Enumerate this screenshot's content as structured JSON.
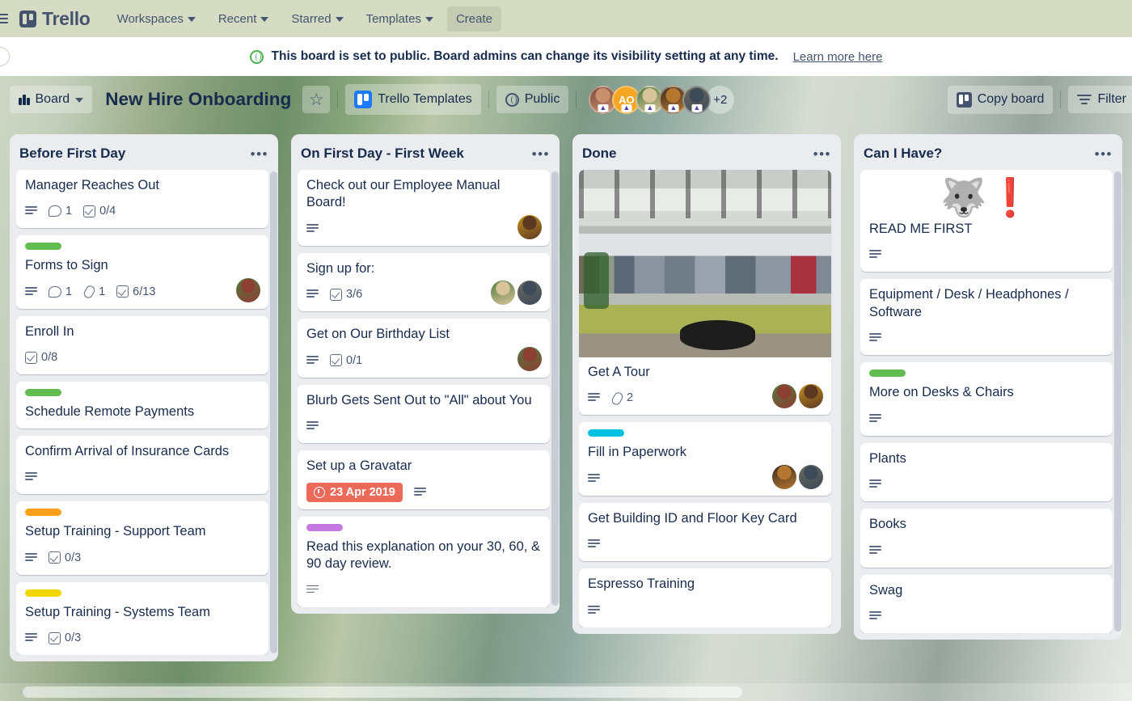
{
  "topnav": {
    "menu_icon": "hamburger-icon",
    "brand": "Trello",
    "items": [
      {
        "label": "Workspaces",
        "has_caret": true,
        "active": false
      },
      {
        "label": "Recent",
        "has_caret": true,
        "active": false
      },
      {
        "label": "Starred",
        "has_caret": true,
        "active": false
      },
      {
        "label": "Templates",
        "has_caret": true,
        "active": false
      },
      {
        "label": "Create",
        "has_caret": false,
        "active": true
      }
    ]
  },
  "banner": {
    "icon": "globe-icon",
    "text": "This board is set to public. Board admins can change its visibility setting at any time.",
    "link": "Learn more here"
  },
  "boardbar": {
    "view_label": "Board",
    "view_icon": "board-view-icon",
    "title": "New Hire Onboarding",
    "star_icon": "star-icon",
    "workspace_label": "Trello Templates",
    "workspace_icon": "trello-logo-icon",
    "visibility_label": "Public",
    "visibility_icon": "globe-icon",
    "members": [
      {
        "type": "photo",
        "name": "member-1",
        "color1": "#7b4a3a",
        "color2": "#c98f6e"
      },
      {
        "type": "initials",
        "name": "member-ao",
        "initials": "AO",
        "color": "#f5a623"
      },
      {
        "type": "photo",
        "name": "member-3",
        "color1": "#4f7a3c",
        "color2": "#d8c49a"
      },
      {
        "type": "photo",
        "name": "member-4",
        "color1": "#3a2a20",
        "color2": "#b5762f"
      },
      {
        "type": "photo",
        "name": "member-5",
        "color1": "#6e6a5a",
        "color2": "#3c4a5a"
      }
    ],
    "members_overflow": "+2",
    "copy_board_label": "Copy board",
    "copy_board_icon": "copy-board-icon",
    "filter_label": "Filter",
    "filter_icon": "filter-icon"
  },
  "lists": [
    {
      "name": "before-first-day",
      "title": "Before First Day",
      "menu_icon": "list-menu-icon",
      "has_scrollbar": true,
      "cards": [
        {
          "name": "manager-reaches-out",
          "title": "Manager Reaches Out",
          "labels": [],
          "badges": [
            {
              "type": "description",
              "value": ""
            },
            {
              "type": "comments",
              "value": "1"
            },
            {
              "type": "checklist",
              "value": "0/4"
            }
          ],
          "avatars": []
        },
        {
          "name": "forms-to-sign",
          "title": "Forms to Sign",
          "labels": [
            "#61bd4f"
          ],
          "badges": [
            {
              "type": "description",
              "value": ""
            },
            {
              "type": "comments",
              "value": "1"
            },
            {
              "type": "attachments",
              "value": "1"
            },
            {
              "type": "checklist",
              "value": "6/13"
            }
          ],
          "avatars": [
            {
              "name": "avatar-member-a",
              "color1": "#4f7a3c",
              "color2": "#8e3f33"
            }
          ]
        },
        {
          "name": "enroll-in",
          "title": "Enroll In",
          "labels": [],
          "badges": [
            {
              "type": "checklist",
              "value": "0/8"
            }
          ],
          "avatars": []
        },
        {
          "name": "schedule-remote-payments",
          "title": "Schedule Remote Payments",
          "labels": [
            "#61bd4f"
          ],
          "badges": [],
          "avatars": []
        },
        {
          "name": "confirm-arrival-of-insurance-cards",
          "title": "Confirm Arrival of Insurance Cards",
          "labels": [],
          "badges": [
            {
              "type": "description",
              "value": ""
            }
          ],
          "avatars": []
        },
        {
          "name": "setup-training-support-team",
          "title": "Setup Training - Support Team",
          "labels": [
            "#ff9f1a"
          ],
          "badges": [
            {
              "type": "description",
              "value": ""
            },
            {
              "type": "checklist",
              "value": "0/3"
            }
          ],
          "avatars": []
        },
        {
          "name": "setup-training-systems-team",
          "title": "Setup Training - Systems Team",
          "labels": [
            "#f2d600"
          ],
          "badges": [
            {
              "type": "description",
              "value": ""
            },
            {
              "type": "checklist",
              "value": "0/3"
            }
          ],
          "avatars": []
        }
      ]
    },
    {
      "name": "on-first-day-first-week",
      "title": "On First Day - First Week",
      "menu_icon": "list-menu-icon",
      "has_scrollbar": true,
      "cards": [
        {
          "name": "check-out-our-employee-manual-board",
          "title": "Check out our Employee Manual Board!",
          "labels": [],
          "badges": [
            {
              "type": "description",
              "value": ""
            }
          ],
          "avatars": [
            {
              "name": "avatar-member-b",
              "color1": "#c9911f",
              "color2": "#5c3a22"
            }
          ]
        },
        {
          "name": "sign-up-for",
          "title": "Sign up for:",
          "labels": [],
          "badges": [
            {
              "type": "description",
              "value": ""
            },
            {
              "type": "checklist",
              "value": "3/6"
            }
          ],
          "avatars": [
            {
              "name": "avatar-member-c",
              "color1": "#4f7a3c",
              "color2": "#d8c49a"
            },
            {
              "name": "avatar-member-d",
              "color1": "#6e6a5a",
              "color2": "#3c4a5a"
            }
          ]
        },
        {
          "name": "get-on-our-birthday-list",
          "title": "Get on Our Birthday List",
          "labels": [],
          "badges": [
            {
              "type": "description",
              "value": ""
            },
            {
              "type": "checklist",
              "value": "0/1"
            }
          ],
          "avatars": [
            {
              "name": "avatar-member-a",
              "color1": "#4f7a3c",
              "color2": "#8e3f33"
            }
          ]
        },
        {
          "name": "blurb-gets-sent-out-to-all-about-you",
          "title": "Blurb Gets Sent Out to \"All\" about You",
          "labels": [],
          "badges": [
            {
              "type": "description",
              "value": ""
            }
          ],
          "avatars": []
        },
        {
          "name": "set-up-a-gravatar",
          "title": "Set up a Gravatar",
          "labels": [],
          "badges": [
            {
              "type": "due",
              "value": "23 Apr 2019"
            },
            {
              "type": "description",
              "value": ""
            }
          ],
          "avatars": []
        },
        {
          "name": "read-this-explanation-30-60-90-day-review",
          "title": "Read this explanation on your 30, 60, & 90 day review.",
          "labels": [
            "#c377e0"
          ],
          "badges": [
            {
              "type": "description",
              "value": ""
            }
          ],
          "avatars": []
        }
      ]
    },
    {
      "name": "done",
      "title": "Done",
      "menu_icon": "list-menu-icon",
      "has_scrollbar": false,
      "cards": [
        {
          "name": "get-a-tour",
          "title": "Get A Tour",
          "cover": "office-cafeteria-photo",
          "labels": [],
          "badges": [
            {
              "type": "description",
              "value": ""
            },
            {
              "type": "attachments",
              "value": "2"
            }
          ],
          "avatars": [
            {
              "name": "avatar-member-a",
              "color1": "#4f7a3c",
              "color2": "#8e3f33"
            },
            {
              "name": "avatar-member-b",
              "color1": "#c9911f",
              "color2": "#5c3a22"
            }
          ]
        },
        {
          "name": "fill-in-paperwork",
          "title": "Fill in Paperwork",
          "labels": [
            "#00c2e0"
          ],
          "badges": [
            {
              "type": "description",
              "value": ""
            }
          ],
          "avatars": [
            {
              "name": "avatar-member-e",
              "color1": "#3a2a20",
              "color2": "#b5762f"
            },
            {
              "name": "avatar-member-d",
              "color1": "#6e6a5a",
              "color2": "#3c4a5a"
            }
          ]
        },
        {
          "name": "get-building-id-and-floor-key-card",
          "title": "Get Building ID and Floor Key Card",
          "labels": [],
          "badges": [
            {
              "type": "description",
              "value": ""
            }
          ],
          "avatars": []
        },
        {
          "name": "espresso-training",
          "title": "Espresso Training",
          "labels": [],
          "badges": [
            {
              "type": "description",
              "value": ""
            }
          ],
          "avatars": []
        }
      ]
    },
    {
      "name": "can-i-have",
      "title": "Can I Have?",
      "menu_icon": "list-menu-icon",
      "has_scrollbar": true,
      "cards": [
        {
          "name": "read-me-first",
          "title": "READ ME FIRST",
          "sticker": "husky-alert-sticker",
          "labels": [],
          "badges": [
            {
              "type": "description",
              "value": ""
            }
          ],
          "avatars": []
        },
        {
          "name": "equipment-desk-headphones-software",
          "title": "Equipment / Desk / Headphones / Software",
          "labels": [],
          "badges": [
            {
              "type": "description",
              "value": ""
            }
          ],
          "avatars": []
        },
        {
          "name": "more-on-desks-and-chairs",
          "title": "More on Desks & Chairs",
          "labels": [
            "#61bd4f"
          ],
          "badges": [
            {
              "type": "description",
              "value": ""
            }
          ],
          "avatars": []
        },
        {
          "name": "plants",
          "title": "Plants",
          "labels": [],
          "badges": [
            {
              "type": "description",
              "value": ""
            }
          ],
          "avatars": []
        },
        {
          "name": "books",
          "title": "Books",
          "labels": [],
          "badges": [
            {
              "type": "description",
              "value": ""
            }
          ],
          "avatars": []
        },
        {
          "name": "swag",
          "title": "Swag",
          "labels": [],
          "badges": [
            {
              "type": "description",
              "value": ""
            }
          ],
          "avatars": []
        }
      ]
    }
  ]
}
